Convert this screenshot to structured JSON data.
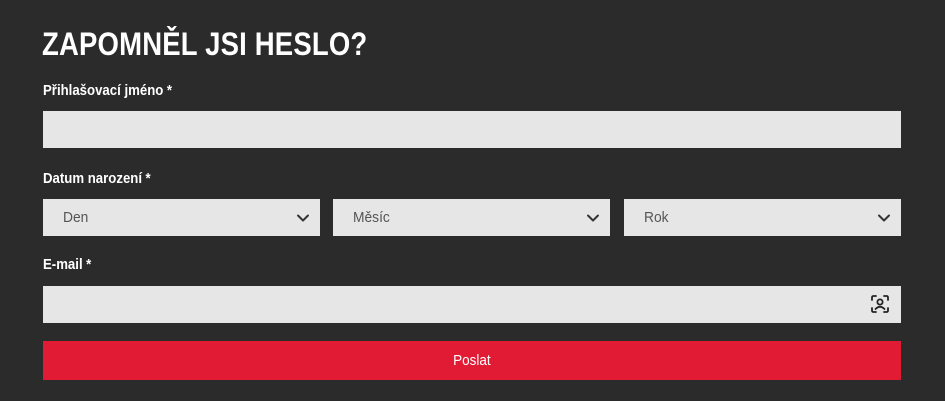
{
  "title": "ZAPOMNĚL JSI HESLO?",
  "form": {
    "username": {
      "label": "Přihlašovací jméno",
      "required_mark": "*",
      "value": "",
      "placeholder": ""
    },
    "birthdate": {
      "label": "Datum narození",
      "required_mark": "*",
      "day": {
        "selected": "Den"
      },
      "month": {
        "selected": "Měsíc"
      },
      "year": {
        "selected": "Rok"
      }
    },
    "email": {
      "label": "E-mail",
      "required_mark": "*",
      "value": "",
      "placeholder": "",
      "icon": "contact-card-icon"
    },
    "submit_label": "Poslat"
  },
  "colors": {
    "background": "#2b2b2b",
    "field": "#e6e6e6",
    "accent": "#e21b35",
    "text": "#ffffff"
  },
  "icons": {
    "select_chevron": "chevron-down-icon",
    "email_autofill": "contact-card-icon"
  }
}
